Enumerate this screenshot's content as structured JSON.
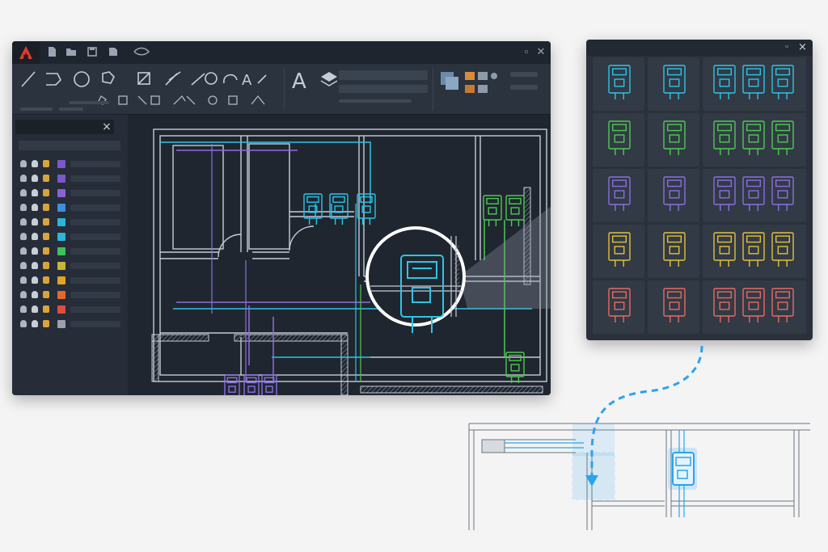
{
  "app": {
    "window_controls": [
      "close-icon"
    ],
    "ribbon_groups": [
      "draw-panel",
      "modify-panel",
      "annotation-panel",
      "layers-panel",
      "block-panel"
    ]
  },
  "layers_panel": {
    "close_glyph": "×",
    "swatches": [
      "#7b57c8",
      "#7b57c8",
      "#8a63d2",
      "#3f8edc",
      "#2bb5d8",
      "#2bb5d8",
      "#3fbf5c",
      "#c9b33a",
      "#e0a326",
      "#e0692d",
      "#e04c3c",
      "#9aa1ab"
    ]
  },
  "colors": {
    "cyan": "#2ec4e6",
    "green": "#4fc954",
    "purple": "#8b6fe0",
    "yellow": "#e2c13a",
    "red": "#e86a62",
    "accent": "#2ba3ee",
    "wall": "#c6ccd5"
  },
  "block_library": {
    "rows": [
      "cyan",
      "green",
      "purple",
      "yellow",
      "red"
    ],
    "close_glyph": "×"
  }
}
